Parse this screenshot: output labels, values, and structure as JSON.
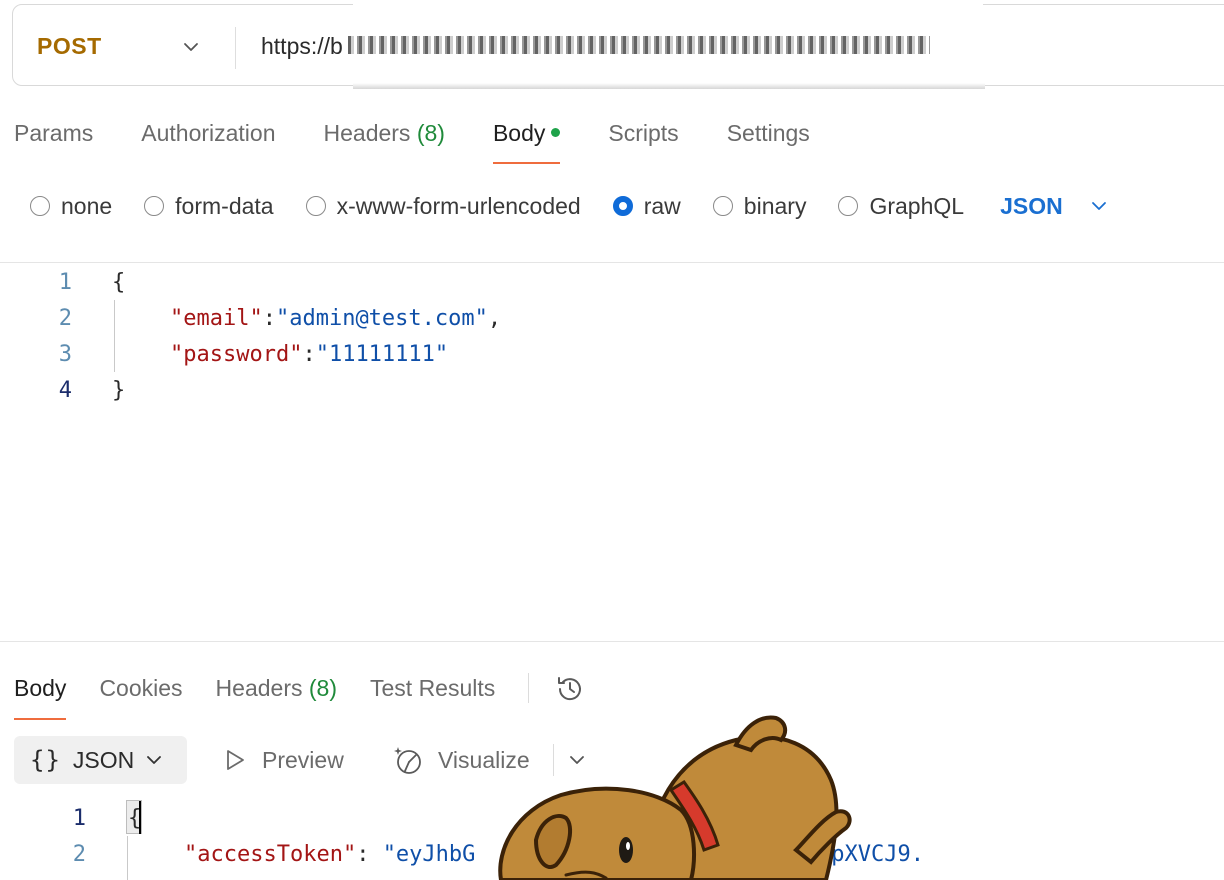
{
  "request": {
    "method": "POST",
    "url": "https://b"
  },
  "request_tabs": [
    {
      "label": "Params"
    },
    {
      "label": "Authorization"
    },
    {
      "label": "Headers",
      "count": "(8)"
    },
    {
      "label": "Body"
    },
    {
      "label": "Scripts"
    },
    {
      "label": "Settings"
    }
  ],
  "body_types": {
    "options": [
      "none",
      "form-data",
      "x-www-form-urlencoded",
      "raw",
      "binary",
      "GraphQL"
    ],
    "selected": "raw",
    "language": "JSON"
  },
  "request_body": {
    "line_numbers": [
      "1",
      "2",
      "3",
      "4"
    ],
    "open_brace": "{",
    "close_brace": "}",
    "email_key": "\"email\"",
    "email_value": "\"admin@test.com\"",
    "password_key": "\"password\"",
    "password_value": "\"11111111\"",
    "colon": ":",
    "comma": ","
  },
  "response_tabs": [
    {
      "label": "Body"
    },
    {
      "label": "Cookies"
    },
    {
      "label": "Headers",
      "count": "(8)"
    },
    {
      "label": "Test Results"
    }
  ],
  "response_toolbar": {
    "format_braces": "{}",
    "format": "JSON",
    "preview": "Preview",
    "visualize": "Visualize"
  },
  "response_body": {
    "line_numbers": [
      "1",
      "2"
    ],
    "open_brace": "{",
    "token_key": "\"accessToken\"",
    "colon": ":",
    "token_value_start": "\"eyJhbG",
    "token_value_end": "kpXVCJ9."
  },
  "colors": {
    "method": "#a56a00",
    "accent_tab": "#ef6c3d",
    "radio_selected": "#0f6bd8",
    "count_green": "#1f8a3a",
    "json_key": "#a31515",
    "json_string": "#0f4fa8"
  }
}
